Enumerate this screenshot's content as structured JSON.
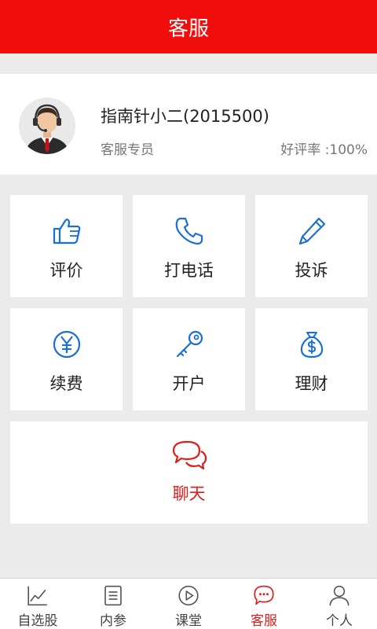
{
  "header": {
    "title": "客服"
  },
  "agent": {
    "name": "指南针小二(2015500)",
    "role": "客服专员",
    "rating": "好评率 :100%"
  },
  "tiles": [
    {
      "label": "评价",
      "icon": "thumbs-up-icon"
    },
    {
      "label": "打电话",
      "icon": "phone-icon"
    },
    {
      "label": "投诉",
      "icon": "pencil-icon"
    },
    {
      "label": "续费",
      "icon": "yen-icon"
    },
    {
      "label": "开户",
      "icon": "key-icon"
    },
    {
      "label": "理财",
      "icon": "money-bag-icon"
    }
  ],
  "chat": {
    "label": "聊天",
    "icon": "chat-bubbles-icon"
  },
  "nav": {
    "active": "客服",
    "items": [
      {
        "label": "自选股",
        "icon": "stock-chart-icon"
      },
      {
        "label": "内参",
        "icon": "document-icon"
      },
      {
        "label": "课堂",
        "icon": "play-icon"
      },
      {
        "label": "客服",
        "icon": "chat-icon"
      },
      {
        "label": "个人",
        "icon": "person-icon"
      }
    ]
  },
  "colors": {
    "brand_red": "#f20d0d",
    "accent_red": "#e21b1b",
    "icon_blue": "#1a6fd6",
    "background": "#ebebeb"
  }
}
